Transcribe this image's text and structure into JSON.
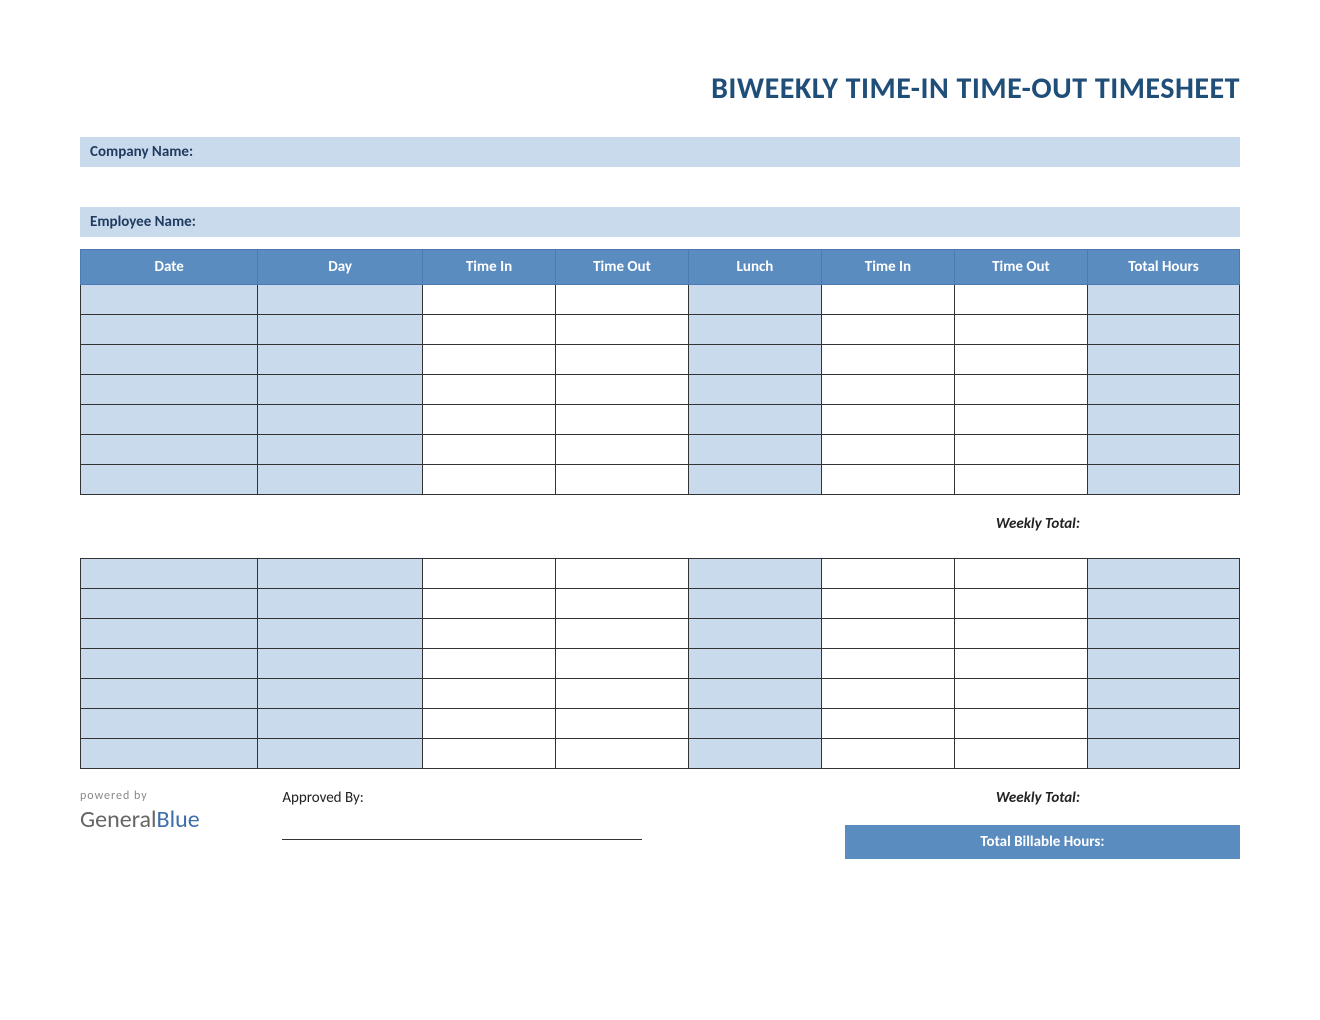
{
  "title": "BIWEEKLY TIME-IN TIME-OUT TIMESHEET",
  "info": {
    "company_label": "Company Name:",
    "employee_label": "Employee Name:"
  },
  "columns": [
    "Date",
    "Day",
    "Time In",
    "Time Out",
    "Lunch",
    "Time In",
    "Time Out",
    "Total Hours"
  ],
  "weekly_total_label": "Weekly Total:",
  "approved_by_label": "Approved By:",
  "total_billable_label": "Total Billable Hours:",
  "brand": {
    "powered": "powered by",
    "name_a": "General",
    "name_b": "Blue"
  },
  "week1_rows": 7,
  "week2_rows": 7,
  "shaded_cols": [
    0,
    1,
    4,
    7
  ]
}
